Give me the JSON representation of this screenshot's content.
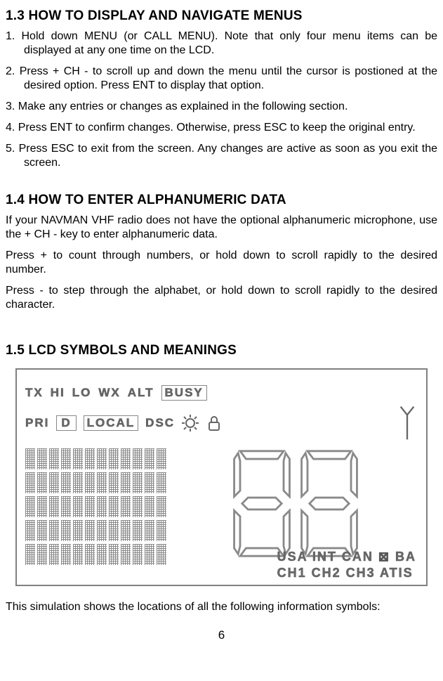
{
  "section13": {
    "heading": "1.3 HOW TO DISPLAY AND NAVIGATE MENUS",
    "steps": [
      "1. Hold down MENU (or CALL MENU). Note that only four menu items can be displayed at any one time on the LCD.",
      "2. Press + CH - to scroll up and down the menu until the cursor is postioned at the desired option. Press ENT to display that option.",
      "3. Make any entries or changes as explained in the following section.",
      "4. Press ENT to confirm changes. Otherwise, press ESC to keep the original entry.",
      "5. Press ESC to exit from the screen. Any changes are active as soon as you exit the screen."
    ]
  },
  "section14": {
    "heading": "1.4 HOW TO ENTER ALPHANUMERIC DATA",
    "p1": "If your NAVMAN VHF radio does not have the optional alphanumeric microphone, use the + CH - key to enter alphanumeric data.",
    "p2": "Press + to count through numbers, or hold down to scroll rapidly to the desired number.",
    "p3": "Press - to step through the alphabet, or hold down to scroll rapidly to the desired character."
  },
  "section15": {
    "heading": "1.5 LCD SYMBOLS AND MEANINGS",
    "caption": "This simulation shows the locations of all the following information symbols:"
  },
  "lcd": {
    "row1": [
      "TX",
      "HI",
      "LO",
      "WX",
      "ALT",
      "BUSY"
    ],
    "row2": [
      "PRI",
      "D",
      "LOCAL",
      "DSC"
    ],
    "bottom1": "USA INT CAN ⊠ BA",
    "bottom2": "CH1 CH2 CH3 ATIS"
  },
  "pageNumber": "6"
}
